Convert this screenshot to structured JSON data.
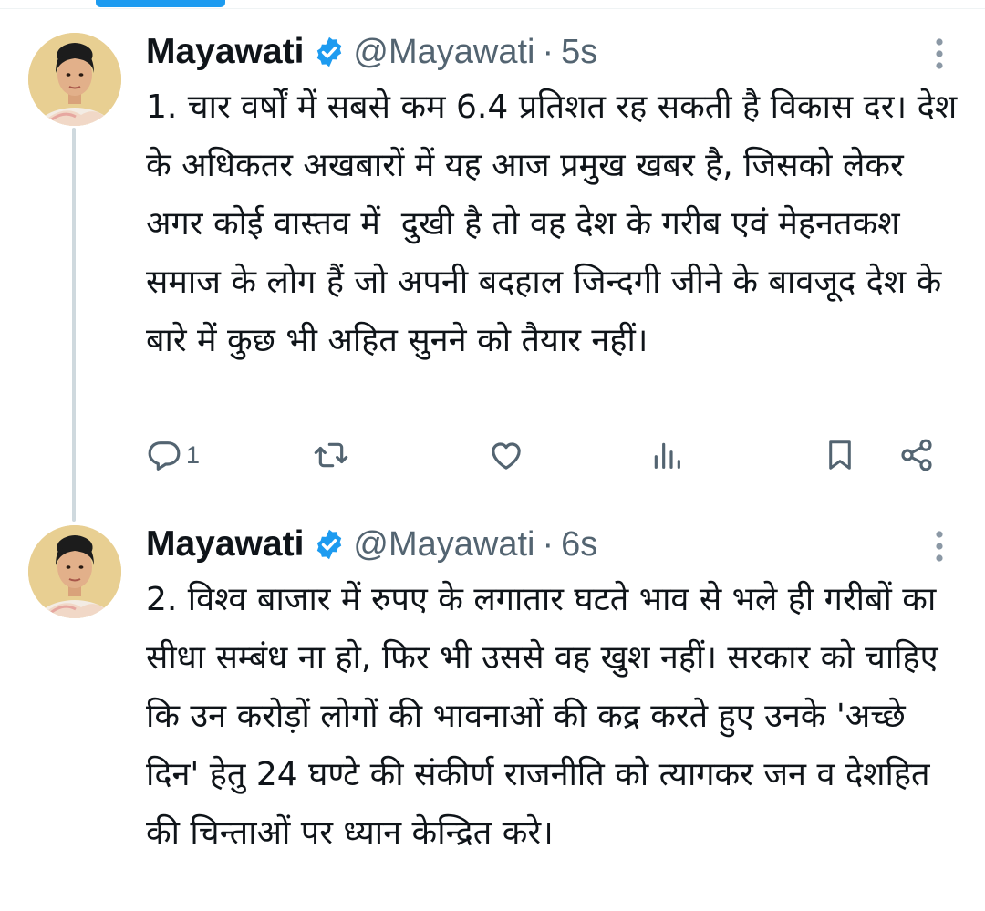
{
  "tweets": [
    {
      "display_name": "Mayawati",
      "handle": "@Mayawati",
      "separator": "·",
      "time": "5s",
      "text": "1. चार वर्षों में सबसे कम 6.4 प्रतिशत रह सकती है विकास दर। देश के अधिकतर अखबारों में यह आज प्रमुख खबर है, जिसको लेकर अगर कोई वास्तव में  दुखी है तो वह देश के गरीब एवं मेहनतकश समाज के लोग हैं जो अपनी बदहाल जिन्दगी जीने के बावजूद देश के बारे में कुछ भी अहित सुनने को तैयार नहीं।",
      "reply_count": "1",
      "verified_icon": "verified-badge-icon",
      "avatar_icon": "profile-photo"
    },
    {
      "display_name": "Mayawati",
      "handle": "@Mayawati",
      "separator": "·",
      "time": "6s",
      "text": "2. विश्व बाजार में रुपए के लगातार घटते भाव से भले ही गरीबों का सीधा सम्बंध ना हो, फिर भी उससे वह खुश नहीं। सरकार को चाहिए कि उन करोड़ों लोगों की भावनाओं की कद्र करते हुए उनके 'अच्छे दिन' हेतु 24 घण्टे की संकीर्ण राजनीति को त्यागकर जन व देशहित की चिन्ताओं पर ध्यान केन्द्रित करे।",
      "verified_icon": "verified-badge-icon",
      "avatar_icon": "profile-photo"
    }
  ],
  "action_icons": [
    "reply-icon",
    "retweet-icon",
    "like-icon",
    "views-icon",
    "bookmark-icon",
    "share-icon"
  ],
  "colors": {
    "accent": "#1d9bf0",
    "text_primary": "#0f1419",
    "text_secondary": "#536471",
    "thread_line": "#cfd9de"
  }
}
